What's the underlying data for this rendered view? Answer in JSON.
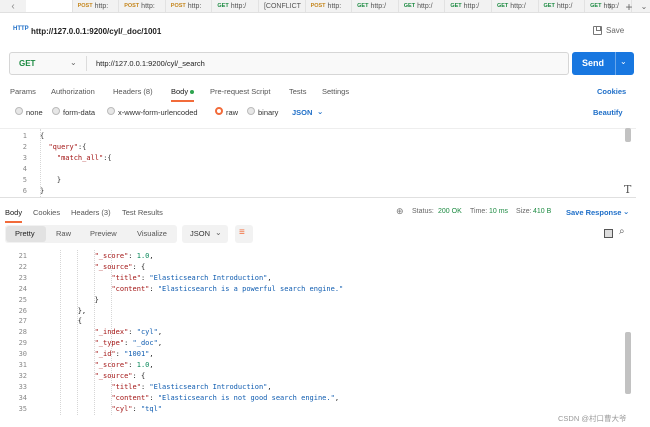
{
  "tab_strip": {
    "tabs": [
      {
        "method": "",
        "label": ""
      },
      {
        "method": "POST",
        "label": "http:"
      },
      {
        "method": "POST",
        "label": "http:"
      },
      {
        "method": "POST",
        "label": "http:"
      },
      {
        "method": "GET",
        "label": "http:/"
      },
      {
        "method": "",
        "label": "[CONFLICT"
      },
      {
        "method": "POST",
        "label": "http:"
      },
      {
        "method": "GET",
        "label": "http:/"
      },
      {
        "method": "GET",
        "label": "http:/"
      },
      {
        "method": "GET",
        "label": "http:/"
      },
      {
        "method": "GET",
        "label": "http:/"
      },
      {
        "method": "GET",
        "label": "http:/"
      },
      {
        "method": "GET",
        "label": "http:/"
      }
    ]
  },
  "request": {
    "icon_text": "HTTP",
    "title": "http://127.0.0.1:9200/cyl/_doc/1001",
    "save_label": "Save",
    "method": "GET",
    "url": "http://127.0.0.1:9200/cyl/_search",
    "send_label": "Send"
  },
  "request_tabs": {
    "params": "Params",
    "authorization": "Authorization",
    "headers": "Headers (8)",
    "body": "Body",
    "pre_request": "Pre-request Script",
    "tests": "Tests",
    "settings": "Settings",
    "cookies": "Cookies"
  },
  "body_types": {
    "none": "none",
    "form_data": "form-data",
    "urlencoded": "x-www-form-urlencoded",
    "raw": "raw",
    "binary": "binary",
    "format": "JSON",
    "beautify": "Beautify"
  },
  "request_body": {
    "lines": [
      {
        "n": "1",
        "t": "{"
      },
      {
        "n": "2",
        "t": "  \"query\":{"
      },
      {
        "n": "3",
        "t": "    \"match_all\":{"
      },
      {
        "n": "4",
        "t": ""
      },
      {
        "n": "5",
        "t": "    }"
      },
      {
        "n": "6",
        "t": "}"
      }
    ]
  },
  "response_tabs": {
    "body": "Body",
    "cookies": "Cookies",
    "headers": "Headers (3)",
    "test_results": "Test Results",
    "status_label": "Status:",
    "status_value": "200 OK",
    "time_label": "Time:",
    "time_value": "10 ms",
    "size_label": "Size:",
    "size_value": "410 B",
    "save_response": "Save Response"
  },
  "response_toolbar": {
    "pretty": "Pretty",
    "raw": "Raw",
    "preview": "Preview",
    "visualize": "Visualize",
    "format": "JSON"
  },
  "response_body": {
    "lines": [
      {
        "n": "21",
        "t": "            \"_score\": 1.0,"
      },
      {
        "n": "22",
        "t": "            \"_source\": {"
      },
      {
        "n": "23",
        "t": "                \"title\": \"Elasticsearch Introduction\","
      },
      {
        "n": "24",
        "t": "                \"content\": \"Elasticsearch is a powerful search engine.\""
      },
      {
        "n": "25",
        "t": "            }"
      },
      {
        "n": "26",
        "t": "        },"
      },
      {
        "n": "27",
        "t": "        {"
      },
      {
        "n": "28",
        "t": "            \"_index\": \"cyl\","
      },
      {
        "n": "29",
        "t": "            \"_type\": \"_doc\","
      },
      {
        "n": "30",
        "t": "            \"_id\": \"1001\","
      },
      {
        "n": "31",
        "t": "            \"_score\": 1.0,"
      },
      {
        "n": "32",
        "t": "            \"_source\": {"
      },
      {
        "n": "33",
        "t": "                \"title\": \"Elasticsearch Introduction\","
      },
      {
        "n": "34",
        "t": "                \"content\": \"Elasticsearch is not good search engine.\","
      },
      {
        "n": "35",
        "t": "                \"cyl\": \"tql\""
      }
    ]
  },
  "watermark": "CSDN @村口曹大爷",
  "colors": {
    "accent": "#f26b3a",
    "send": "#1877e0",
    "get": "#1c8a41",
    "post": "#c5861c",
    "link": "#1f6fc8"
  }
}
